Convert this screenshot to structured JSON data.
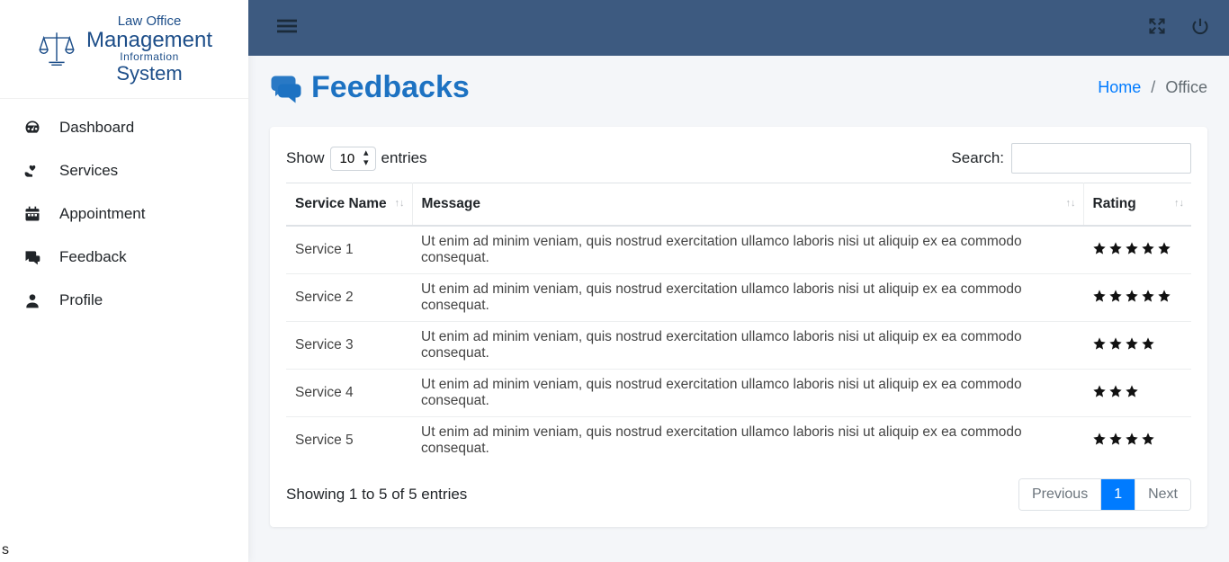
{
  "brand": {
    "line1": "Law Office",
    "line2": "Management",
    "line3": "Information",
    "line4": "System"
  },
  "sidebar": {
    "items": [
      {
        "label": "Dashboard",
        "icon": "gauge-icon"
      },
      {
        "label": "Services",
        "icon": "hands-heart-icon"
      },
      {
        "label": "Appointment",
        "icon": "calendar-icon"
      },
      {
        "label": "Feedback",
        "icon": "comments-icon"
      },
      {
        "label": "Profile",
        "icon": "user-icon"
      }
    ]
  },
  "header": {
    "title": "Feedbacks",
    "breadcrumb_home": "Home",
    "breadcrumb_current": "Office"
  },
  "table": {
    "show_label_pre": "Show",
    "show_label_post": "entries",
    "page_length": "10",
    "search_label": "Search:",
    "search_value": "",
    "columns": [
      "Service Name",
      "Message",
      "Rating"
    ],
    "rows": [
      {
        "service": "Service 1",
        "message": "Ut enim ad minim veniam, quis nostrud exercitation ullamco laboris nisi ut aliquip ex ea commodo consequat.",
        "rating": 5
      },
      {
        "service": "Service 2",
        "message": "Ut enim ad minim veniam, quis nostrud exercitation ullamco laboris nisi ut aliquip ex ea commodo consequat.",
        "rating": 5
      },
      {
        "service": "Service 3",
        "message": "Ut enim ad minim veniam, quis nostrud exercitation ullamco laboris nisi ut aliquip ex ea commodo consequat.",
        "rating": 4
      },
      {
        "service": "Service 4",
        "message": "Ut enim ad minim veniam, quis nostrud exercitation ullamco laboris nisi ut aliquip ex ea commodo consequat.",
        "rating": 3
      },
      {
        "service": "Service 5",
        "message": "Ut enim ad minim veniam, quis nostrud exercitation ullamco laboris nisi ut aliquip ex ea commodo consequat.",
        "rating": 4
      }
    ],
    "info": "Showing 1 to 5 of 5 entries",
    "prev": "Previous",
    "next": "Next",
    "current_page": "1"
  },
  "stray": "s"
}
